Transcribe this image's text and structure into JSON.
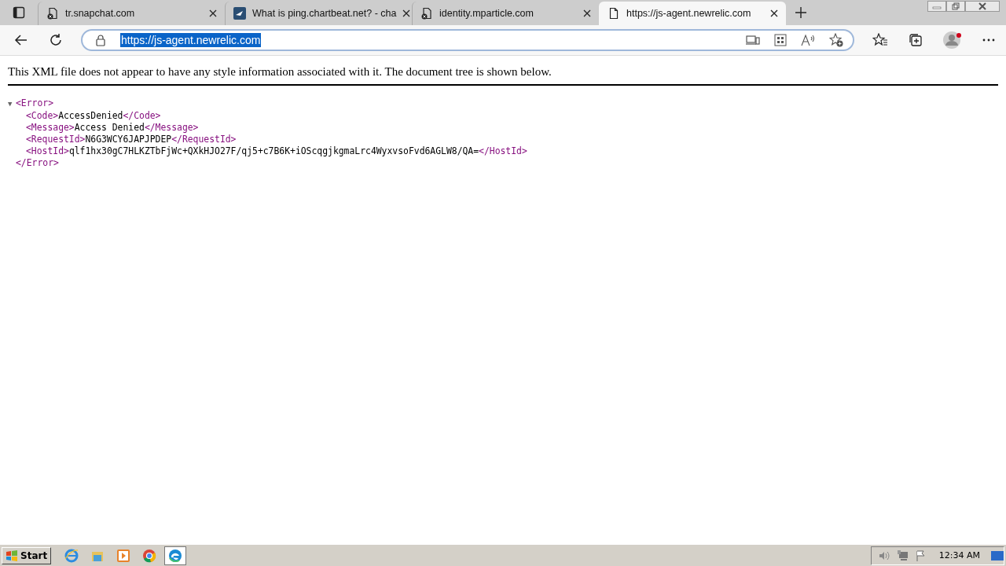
{
  "tabs": [
    {
      "label": "tr.snapchat.com",
      "selected": false,
      "kind": "blocked"
    },
    {
      "label": "What is ping.chartbeat.net? - cha",
      "selected": false,
      "kind": "site"
    },
    {
      "label": "identity.mparticle.com",
      "selected": false,
      "kind": "blocked"
    },
    {
      "label": "https://js-agent.newrelic.com",
      "selected": true,
      "kind": "page"
    }
  ],
  "address_bar": {
    "url": "https://js-agent.newrelic.com",
    "selected": true
  },
  "notice": "This XML file does not appear to have any style information associated with it. The document tree is shown below.",
  "xml": {
    "toggle": "▼",
    "expanded": true,
    "open_tag": "<Error>",
    "close_tag": "</Error>",
    "children": [
      {
        "open_tag": "<Code>",
        "text": "AccessDenied",
        "close_tag": "</Code>"
      },
      {
        "open_tag": "<Message>",
        "text": "Access Denied",
        "close_tag": "</Message>"
      },
      {
        "open_tag": "<RequestId>",
        "text": "N6G3WCY6JAPJPDEP",
        "close_tag": "</RequestId>"
      },
      {
        "open_tag": "<HostId>",
        "text": "qlf1hx30gC7HLKZTbFjWc+QXkHJO27F/qj5+c7B6K+iOScqgjkgmaLrc4WyxvsoFvd6AGLW8/QA=",
        "close_tag": "</HostId>"
      }
    ]
  },
  "taskbar": {
    "start": "Start",
    "apps": [
      {
        "kind": "ie",
        "selected": false
      },
      {
        "kind": "explorer",
        "selected": false
      },
      {
        "kind": "media",
        "selected": false
      },
      {
        "kind": "chrome",
        "selected": false
      },
      {
        "kind": "edge",
        "selected": true
      }
    ],
    "clock": "12:34 AM"
  }
}
